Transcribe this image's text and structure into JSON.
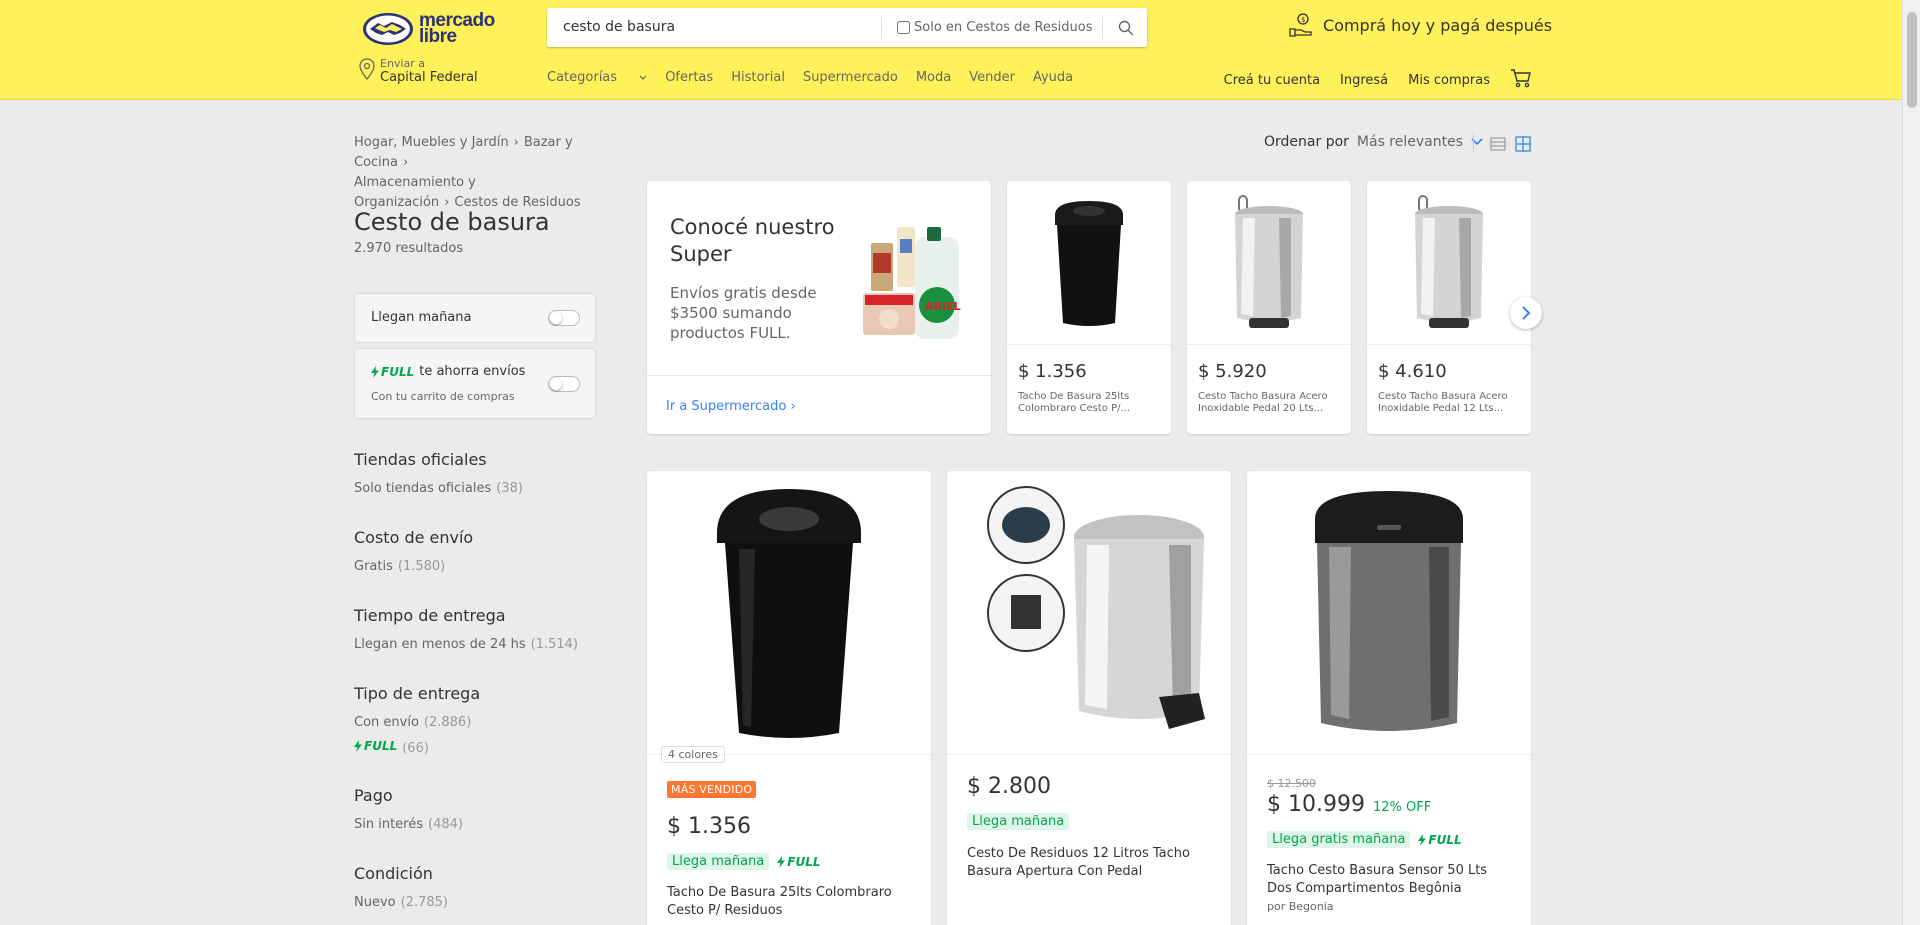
{
  "header": {
    "logo_line1": "mercado",
    "logo_line2": "libre",
    "search_value": "cesto de basura",
    "search_scope_label": "Solo en Cestos de Residuos",
    "promo_text": "Comprá hoy y pagá después",
    "location_small": "Enviar a",
    "location_big": "Capital Federal",
    "nav": [
      {
        "label": "Categorías"
      },
      {
        "label": "Ofertas"
      },
      {
        "label": "Historial"
      },
      {
        "label": "Supermercado"
      },
      {
        "label": "Moda"
      },
      {
        "label": "Vender"
      },
      {
        "label": "Ayuda"
      }
    ],
    "account": {
      "create": "Creá tu cuenta",
      "login": "Ingresá",
      "purchases": "Mis compras"
    }
  },
  "breadcrumb": [
    "Hogar, Muebles y Jardín",
    "Bazar y Cocina",
    "Almacenamiento y Organización",
    "Cestos de Residuos"
  ],
  "search_result": {
    "title": "Cesto de basura",
    "count": "2.970 resultados"
  },
  "quick_filters": {
    "tomorrow": "Llegan mañana",
    "full_brand": "FULL",
    "full_text": "te ahorra envíos",
    "full_sub": "Con tu carrito de compras"
  },
  "filters": [
    {
      "title": "Tiendas oficiales",
      "items": [
        {
          "label": "Solo tiendas oficiales",
          "count": "(38)"
        }
      ]
    },
    {
      "title": "Costo de envío",
      "items": [
        {
          "label": "Gratis",
          "count": "(1.580)"
        }
      ]
    },
    {
      "title": "Tiempo de entrega",
      "items": [
        {
          "label": "Llegan en menos de 24 hs",
          "count": "(1.514)"
        }
      ]
    },
    {
      "title": "Tipo de entrega",
      "items": [
        {
          "label": "Con envío",
          "count": "(2.886)"
        },
        {
          "label": "FULL",
          "count": "(66)"
        }
      ]
    },
    {
      "title": "Pago",
      "items": [
        {
          "label": "Sin interés",
          "count": "(484)"
        }
      ]
    },
    {
      "title": "Condición",
      "items": [
        {
          "label": "Nuevo",
          "count": "(2.785)"
        }
      ]
    }
  ],
  "sort": {
    "label": "Ordenar por",
    "value": "Más relevantes"
  },
  "super_promo": {
    "title": "Conocé nuestro Super",
    "subtitle": "Envíos gratis desde $3500 sumando productos FULL.",
    "link": "Ir a Supermercado",
    "product_label": "ARIEL"
  },
  "carousel": [
    {
      "price": "$ 1.356",
      "title": "Tacho De Basura 25lts Colombraro Cesto P/..."
    },
    {
      "price": "$ 5.920",
      "title": "Cesto Tacho Basura Acero Inoxidable Pedal 20 Lts..."
    },
    {
      "price": "$ 4.610",
      "title": "Cesto Tacho Basura Acero Inoxidable Pedal 12 Lts..."
    }
  ],
  "products": [
    {
      "colors": "4 colores",
      "badge": "MÁS VENDIDO",
      "price": "$ 1.356",
      "delivery": "Llega mañana",
      "full": "FULL",
      "title": "Tacho De Basura 25lts Colombraro Cesto P/ Residuos"
    },
    {
      "price": "$ 2.800",
      "delivery": "Llega mañana",
      "title": "Cesto De Residuos 12 Litros Tacho Basura Apertura Con Pedal"
    },
    {
      "old_price": "$ 12.500",
      "price": "$ 10.999",
      "discount": "12% OFF",
      "delivery": "Llega gratis mañana",
      "full": "FULL",
      "title": "Tacho Cesto Basura Sensor 50 Lts Dos Compartimentos Begônia",
      "brand": "por Begonia"
    }
  ],
  "colors": {
    "header_yellow": "#fff159",
    "accent_blue": "#3483fa",
    "green": "#00a650",
    "badge_orange": "#ff7733"
  }
}
